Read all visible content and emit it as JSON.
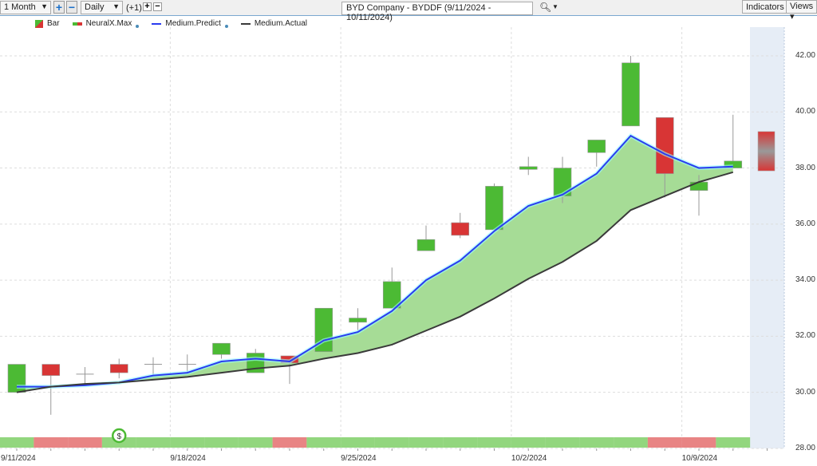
{
  "toolbar": {
    "range": "1 Month",
    "interval": "Daily",
    "offset": "(+1)",
    "title": "BYD Company - BYDDF (9/11/2024 - 10/11/2024)",
    "indicators": "Indicators",
    "views": "Views"
  },
  "legend": [
    "Bar",
    "NeuralX.Max",
    "Medium.Predict",
    "Medium.Actual"
  ],
  "colors": {
    "up": "#4cba34",
    "down": "#d83535",
    "predict": "#2b3cf0",
    "actual": "#3a3a3a",
    "fill": "#a6dc96",
    "signal_up": "#92d67e",
    "signal_down": "#e88484"
  },
  "signal_icon": "$",
  "chart_data": {
    "type": "candlestick",
    "title": "BYD Company - BYDDF (9/11/2024 - 10/11/2024)",
    "ylim": [
      28,
      42
    ],
    "yticks": [
      "42.00",
      "40.00",
      "38.00",
      "36.00",
      "34.00",
      "32.00",
      "30.00",
      "28.00"
    ],
    "xticks": [
      {
        "label": "9/11/2024",
        "index": 0
      },
      {
        "label": "9/18/2024",
        "index": 4.5
      },
      {
        "label": "9/25/2024",
        "index": 9.5
      },
      {
        "label": "10/2/2024",
        "index": 14.5
      },
      {
        "label": "10/9/2024",
        "index": 19.5
      }
    ],
    "candles": [
      [
        30.0,
        31.0,
        30.0,
        31.0
      ],
      [
        31.0,
        31.0,
        29.2,
        30.6
      ],
      [
        30.65,
        30.9,
        30.3,
        30.65
      ],
      [
        31.0,
        31.2,
        30.5,
        30.7
      ],
      [
        31.0,
        31.25,
        30.6,
        31.0
      ],
      [
        31.0,
        31.35,
        30.7,
        31.0
      ],
      [
        31.35,
        31.75,
        31.2,
        31.75
      ],
      [
        30.7,
        31.55,
        30.7,
        31.4
      ],
      [
        31.3,
        31.3,
        30.3,
        31.05
      ],
      [
        31.45,
        33.0,
        31.45,
        33.0
      ],
      [
        32.5,
        33.0,
        32.2,
        32.65
      ],
      [
        33.0,
        34.45,
        33.0,
        33.95
      ],
      [
        35.05,
        35.95,
        35.05,
        35.45
      ],
      [
        36.05,
        36.4,
        35.5,
        35.6
      ],
      [
        35.8,
        37.45,
        35.8,
        37.35
      ],
      [
        37.95,
        38.4,
        37.75,
        38.05
      ],
      [
        37.0,
        38.4,
        36.75,
        38.0
      ],
      [
        38.55,
        39.0,
        38.05,
        39.0
      ],
      [
        39.5,
        42.0,
        39.5,
        41.75
      ],
      [
        39.8,
        39.8,
        36.95,
        37.8
      ],
      [
        37.2,
        37.75,
        36.3,
        37.5
      ],
      [
        38.0,
        39.9,
        38.0,
        38.25
      ]
    ],
    "medium_predict": [
      30.2,
      30.2,
      30.25,
      30.35,
      30.6,
      30.7,
      31.1,
      31.2,
      31.1,
      31.85,
      32.15,
      32.9,
      34.0,
      34.7,
      35.75,
      36.65,
      37.05,
      37.8,
      39.15,
      38.5,
      38.0,
      38.05
    ],
    "medium_actual": [
      30.0,
      30.2,
      30.3,
      30.35,
      30.45,
      30.55,
      30.7,
      30.85,
      30.95,
      31.2,
      31.4,
      31.7,
      32.2,
      32.7,
      33.35,
      34.05,
      34.65,
      35.4,
      36.5,
      37.0,
      37.5,
      37.85
    ],
    "forecast_range": [
      37.9,
      39.3
    ],
    "signals": [
      "up",
      "down",
      "down",
      "up",
      "up",
      "up",
      "up",
      "up",
      "down",
      "up",
      "up",
      "up",
      "up",
      "up",
      "up",
      "up",
      "up",
      "up",
      "up",
      "down",
      "down",
      "up"
    ]
  }
}
